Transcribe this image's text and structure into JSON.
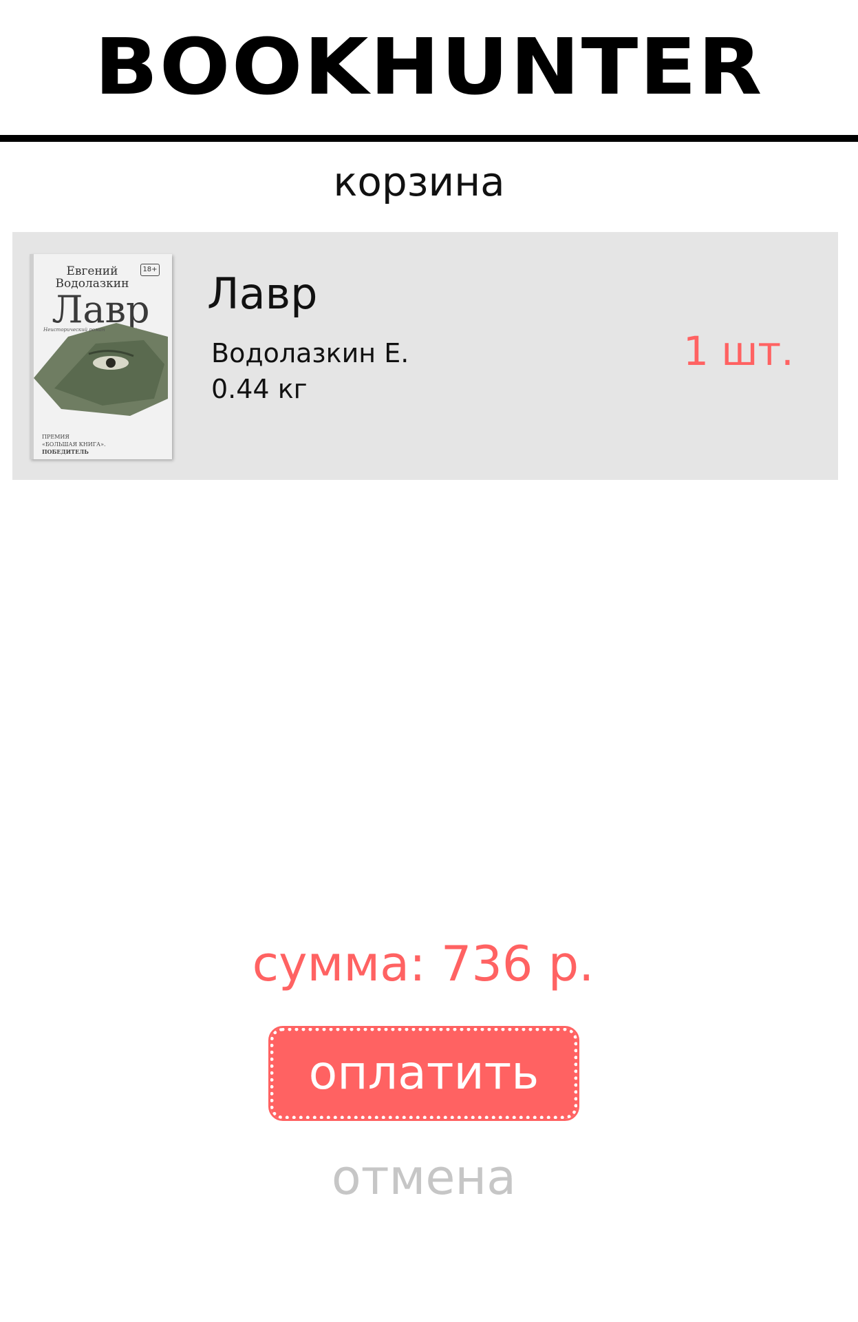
{
  "app": {
    "brand": "BOOKHUNTER"
  },
  "page": {
    "title": "корзина"
  },
  "cart": {
    "items": [
      {
        "title": "Лавр",
        "author": "Водолазкин Е.",
        "weight": "0.44 кг",
        "quantity": "1 шт.",
        "cover": {
          "author_line_1": "Евгений",
          "author_line_2": "Водолазкин",
          "age_rating": "18+",
          "title": "Лавр",
          "subtitle": "Неисторический роман",
          "award_line_1": "ПРЕМИЯ",
          "award_line_2": "«БОЛЬШАЯ КНИГА».",
          "award_line_3": "ПОБЕДИТЕЛЬ"
        }
      }
    ]
  },
  "summary": {
    "total": "сумма: 736 р."
  },
  "actions": {
    "pay_label": "оплатить",
    "cancel_label": "отмена"
  },
  "colors": {
    "accent": "#ff6262",
    "muted": "#c6c6c6",
    "item_background": "#e5e5e5"
  }
}
